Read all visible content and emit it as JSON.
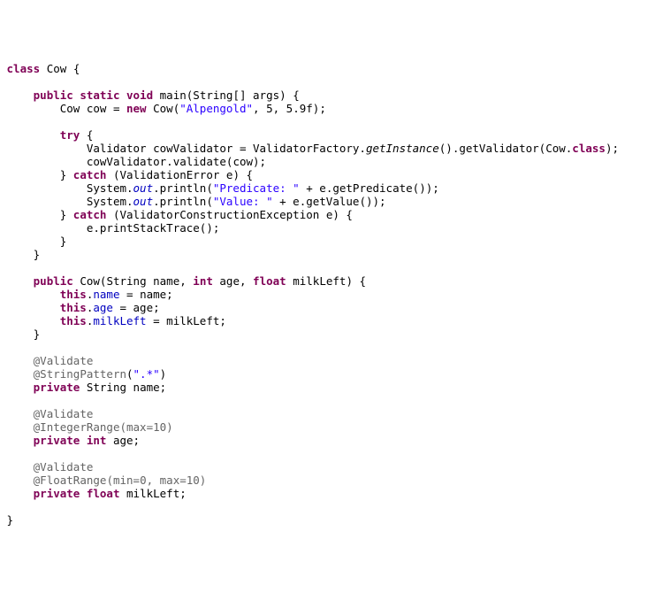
{
  "kw": {
    "class": "class",
    "public": "public",
    "static": "static",
    "void": "void",
    "new": "new",
    "try": "try",
    "catch": "catch",
    "this": "this",
    "private": "private",
    "int": "int",
    "float": "float"
  },
  "id": {
    "Cow": "Cow",
    "main": "main",
    "StringArr": "String[] args",
    "cow": "cow",
    "Validator": "Validator",
    "cowValidator": "cowValidator",
    "ValidatorFactory": "ValidatorFactory",
    "getInstance": "getInstance",
    "getValidator": "getValidator",
    "validate": "validate",
    "ValidationError": "ValidationError",
    "e": "e",
    "System": "System",
    "out": "out",
    "println": "println",
    "getPredicate": "getPredicate",
    "getValue": "getValue",
    "VCE": "ValidatorConstructionException",
    "printStackTrace": "printStackTrace",
    "StringName": "String name",
    "ageParam": "age",
    "milkLeftParam": "milkLeft",
    "name": "name",
    "age": "age",
    "milkLeft": "milkLeft",
    "String": "String",
    "int": "int",
    "float": "float"
  },
  "str": {
    "Alpengold": "\"Alpengold\"",
    "Predicate": "\"Predicate: \"",
    "Value": "\"Value: \"",
    "dotstar": "\".*\""
  },
  "num": {
    "five": "5",
    "fivept9f": "5.9f"
  },
  "ann": {
    "Validate": "@Validate",
    "StringPattern": "@StringPattern",
    "IntegerRange": "@IntegerRange",
    "FloatRange": "@FloatRange",
    "max10": "(max=10)",
    "min0max10": "(min=0, max=10)"
  },
  "punct": {
    "lbrace": "{",
    "rbrace": "}",
    "lparen": "(",
    "rparen": ")",
    "semi": ";",
    "comma": ",",
    "dot": ".",
    "eq": " = ",
    "plus": " + ",
    "dotclass": ".class"
  }
}
